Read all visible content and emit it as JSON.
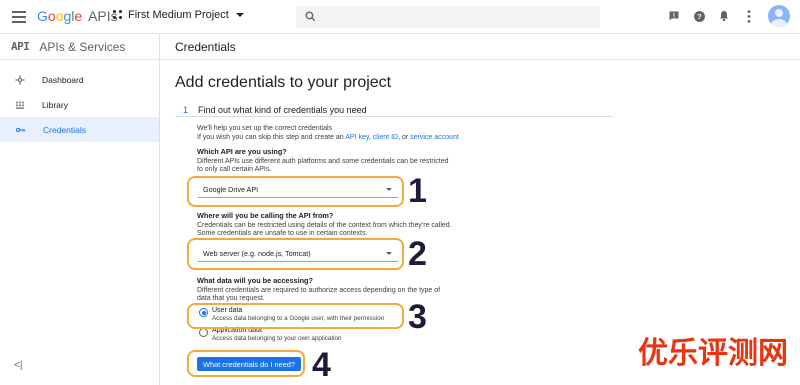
{
  "topbar": {
    "logo_google": [
      "G",
      "o",
      "o",
      "g",
      "l",
      "e"
    ],
    "logo_apis": "APIs",
    "project_name": "First Medium Project",
    "icons": [
      "search-icon",
      "support-icon",
      "help-icon",
      "notifications-icon",
      "more-vert-icon",
      "avatar"
    ]
  },
  "sidebar": {
    "badge": "API",
    "title": "APIs & Services",
    "items": [
      {
        "label": "Dashboard",
        "icon": "dashboard-icon"
      },
      {
        "label": "Library",
        "icon": "library-icon"
      },
      {
        "label": "Credentials",
        "icon": "key-icon",
        "active": true
      }
    ],
    "collapse_label": "<|"
  },
  "page": {
    "header": "Credentials",
    "title": "Add credentials to your project",
    "step_number": "1",
    "step_title": "Find out what kind of credentials you need",
    "intro_line1": "We'll help you set up the correct credentials",
    "intro_line2_prefix": "If you wish you can skip this step and create an",
    "link_api_key": "API key",
    "sep1": ",",
    "link_client_id": "client ID",
    "sep2": ", or",
    "link_service_account": "service account",
    "q1": {
      "heading": "Which API are you using?",
      "desc1": "Different APIs use different auth platforms and some credentials can be restricted",
      "desc2": "to only call certain APIs.",
      "selected": "Google Drive API"
    },
    "q2": {
      "heading": "Where will you be calling the API from?",
      "desc1": "Credentials can be restricted using details of the context from which they're called.",
      "desc2": "Some credentials are unsafe to use in certain contexts.",
      "selected": "Web server (e.g. node.js, Tomcat)"
    },
    "q3": {
      "heading": "What data will you be accessing?",
      "desc1": "Different credentials are required to authorize access depending on the type of",
      "desc2": "data that you request.",
      "options": [
        {
          "label": "User data",
          "sub": "Access data belonging to a Google user, with their permission",
          "checked": true
        },
        {
          "label": "Application data",
          "sub": "Access data belonging to your own application",
          "checked": false
        }
      ]
    },
    "submit_label": "What credentials do I need?",
    "annotations": [
      "1",
      "2",
      "3",
      "4"
    ],
    "accent_colors": {
      "highlight": "#f4a93a",
      "primary": "#1a73e8",
      "annotation": "#1c1c3a"
    }
  },
  "watermark": "优乐评测网"
}
